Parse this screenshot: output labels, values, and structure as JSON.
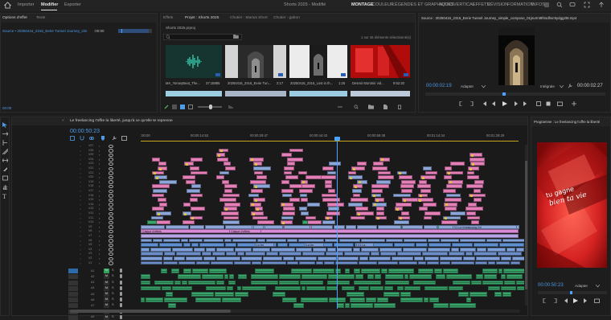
{
  "topbar": {
    "home_icon": "home-icon",
    "tabs": [
      "Importer",
      "Modifier",
      "Exporter"
    ],
    "active_tab": "Modifier",
    "project_title": "Shorts 2025 - Modifié",
    "workspaces": [
      "MONTAGE",
      "COULEUR",
      "LÉGENDES ET GRAPHIQUES",
      "AUDIO",
      "VERTICAL",
      "EFFETS",
      "RÉVISION",
      "FORMATION",
      "INFOS"
    ],
    "active_workspace": "MONTAGE"
  },
  "effect_controls": {
    "tabs": [
      "Options d'effet",
      "Texte"
    ],
    "clip_path": "Source • 20250416_2316_Eerie Tunnel Journey_sim",
    "timecode": ":00:00",
    "bottom_timecode": "00:00"
  },
  "project_panel": {
    "tabs": [
      "Effets",
      "Projet : Shorts 2025",
      "Chutier : Marius Short",
      "Chutier : gabon"
    ],
    "file_name": "Shorts 2025.prproj",
    "selection_info": "1 sur 46 éléments sélectionné(s)",
    "items": [
      {
        "name": "MA_YomeyBeat_The...",
        "duration": "37:15885"
      },
      {
        "name": "20250416_2316_Eerie Tun...",
        "duration": "2:17"
      },
      {
        "name": "20250416_2316_Lost in th...",
        "duration": "1:25"
      },
      {
        "name": "Desmir Montmir vid...",
        "duration": "9:52:20"
      }
    ]
  },
  "source_monitor": {
    "title": "Source : 20250416_2316_Eerie Tunnel Journey_simple_compose_01jsurmt9fnsdhsc9ydgg2t8.mp4",
    "timecode_in": "00:00:02:19",
    "fit_label": "Adapter",
    "quality_label": "Intégrale",
    "timecode_out": "00:00:02:27"
  },
  "timeline": {
    "sequence_tab": "Le freelancing t'offre la liberté, jusqu'à ce qu'elle te reprenne",
    "timecode": "00:00:50:23",
    "ruler_ticks": [
      ":00:00",
      "00:00:14:53",
      "00:00:29:47",
      "00:00:44:43",
      "00:00:59:38",
      "00:01:14:34",
      "00:01:29:29"
    ],
    "video_tracks": [
      "V27",
      "V26",
      "V25",
      "V24",
      "V23",
      "V22",
      "V21",
      "V20",
      "V19",
      "V18",
      "V17",
      "V16",
      "V15",
      "V14",
      "V13",
      "V12",
      "V11",
      "V10",
      "V9",
      "V8",
      "V7",
      "V6",
      "V5",
      "V4",
      "V3",
      "V2",
      "V1"
    ],
    "audio_tracks": [
      "A1",
      "A2",
      "A3",
      "A4",
      "A5",
      "A6",
      "A7",
      "A8",
      "A9"
    ],
    "clip_labels": {
      "calque_effets_1": "Calque d'effets",
      "calque_effets_2": "Calque d'effets",
      "le_fre": "Le fre",
      "la_fre": "La fre",
      "freelancing": "V1 Le freelancing t'of",
      "v1_la": "V1 La"
    }
  },
  "program_monitor": {
    "title": "Programme : Le freelancing t'offre la liberté",
    "overlay_line1": "tu gagne",
    "overlay_line2": "bien ta vie",
    "timecode": "00:00:50:23",
    "fit_label": "Adapter"
  },
  "colors": {
    "accent_blue": "#2d8ceb",
    "playhead": "#4aa3ff",
    "clip_pink": "#e57fb8",
    "clip_blue": "#8ca6d9",
    "clip_green": "#3aa56a",
    "clip_yellow": "#e0c040",
    "program_red": "#d42a2a"
  }
}
